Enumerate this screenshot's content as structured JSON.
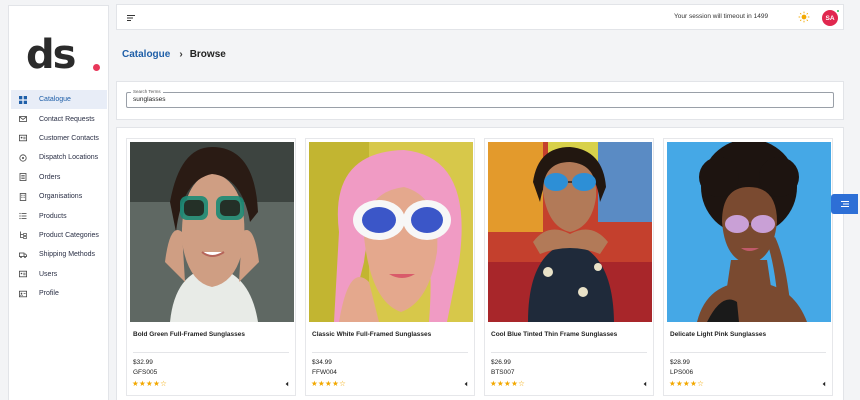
{
  "brand": {
    "logo_text": "ds"
  },
  "sidebar": {
    "items": [
      {
        "label": "Catalogue",
        "icon": "grid-icon",
        "active": true
      },
      {
        "label": "Contact Requests",
        "icon": "mail-icon",
        "active": false
      },
      {
        "label": "Customer Contacts",
        "icon": "id-card-icon",
        "active": false
      },
      {
        "label": "Dispatch Locations",
        "icon": "location-icon",
        "active": false
      },
      {
        "label": "Orders",
        "icon": "orders-icon",
        "active": false
      },
      {
        "label": "Organisations",
        "icon": "building-icon",
        "active": false
      },
      {
        "label": "Products",
        "icon": "list-icon",
        "active": false
      },
      {
        "label": "Product Categories",
        "icon": "tree-icon",
        "active": false
      },
      {
        "label": "Shipping Methods",
        "icon": "truck-icon",
        "active": false
      },
      {
        "label": "Users",
        "icon": "users-icon",
        "active": false
      },
      {
        "label": "Profile",
        "icon": "profile-icon",
        "active": false
      }
    ]
  },
  "header": {
    "session_text": "Your session will timeout in 1499",
    "avatar_initials": "SA",
    "theme_icon": "sun-icon",
    "menu_icon": "menu-icon"
  },
  "breadcrumb": {
    "parent": "Catalogue",
    "separator": "›",
    "current": "Browse"
  },
  "search": {
    "label": "Search Terms",
    "value": "sunglasses"
  },
  "products": [
    {
      "name": "Bold Green Full-Framed Sunglasses",
      "price": "$32.99",
      "sku": "GFS005",
      "rating": 4,
      "stars": "★★★★☆"
    },
    {
      "name": "Classic White Full-Framed Sunglasses",
      "price": "$34.99",
      "sku": "FFW004",
      "rating": 4,
      "stars": "★★★★☆"
    },
    {
      "name": "Cool Blue Tinted Thin Frame Sunglasses",
      "price": "$26.99",
      "sku": "BTS007",
      "rating": 4,
      "stars": "★★★★☆"
    },
    {
      "name": "Delicate Light Pink Sunglasses",
      "price": "$28.99",
      "sku": "LPS006",
      "rating": 4,
      "stars": "★★★★☆"
    }
  ],
  "colors": {
    "accent": "#1f5fa8",
    "brand_dot": "#e8375a",
    "avatar": "#e0284f",
    "star": "#f2a800",
    "side_tab": "#2d6fd6"
  }
}
